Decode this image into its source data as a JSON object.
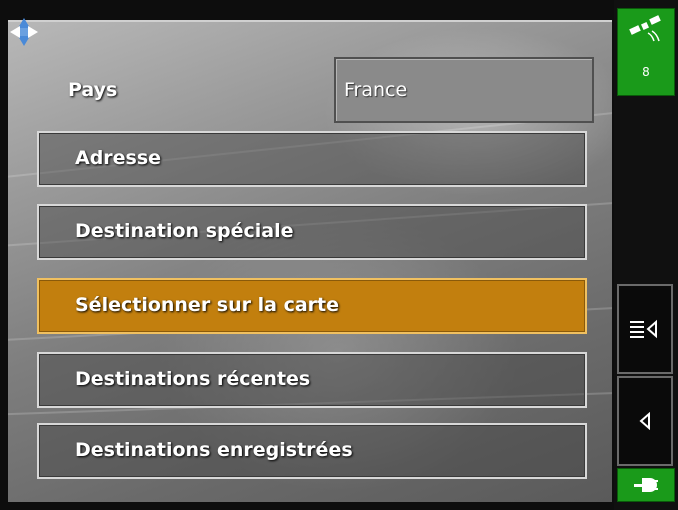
{
  "form": {
    "country_label": "Pays",
    "country_value": "France"
  },
  "menu": {
    "items": [
      {
        "label": "Adresse",
        "selected": false
      },
      {
        "label": "Destination spéciale",
        "selected": false
      },
      {
        "label": "Sélectionner sur la carte",
        "selected": true
      },
      {
        "label": "Destinations récentes",
        "selected": false
      },
      {
        "label": "Destinations enregistrées",
        "selected": false
      }
    ]
  },
  "status": {
    "gps_satellites": "8",
    "gps_icon": "satellite-icon",
    "power_icon": "power-plug-icon"
  },
  "icons": {
    "compass": "compass-arrows-icon",
    "list_back": "list-back-icon",
    "back": "back-arrow-icon"
  },
  "colors": {
    "selected": "#c27f0e",
    "gps_green": "#1a9a1a",
    "background": "#0d0d0d"
  }
}
